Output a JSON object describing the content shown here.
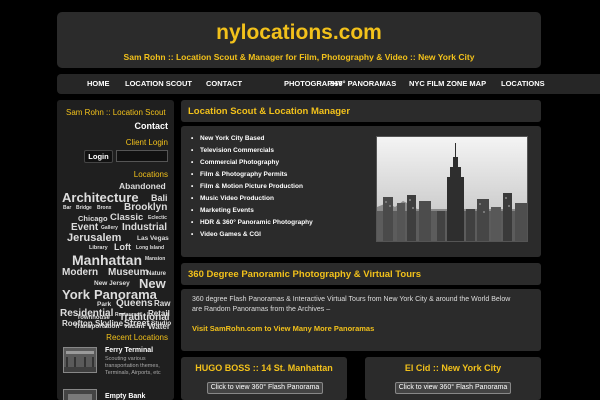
{
  "header": {
    "title": "nylocations.com",
    "subtitle": "Sam Rohn :: Location Scout & Manager for Film, Photography & Video :: New York City"
  },
  "nav": {
    "items": [
      "HOME",
      "LOCATION SCOUT",
      "CONTACT",
      "PHOTOGRAPHY",
      "360° PANORAMAS",
      "NYC FILM ZONE MAP",
      "LOCATIONS"
    ]
  },
  "sidebar": {
    "owner": "Sam Rohn :: Location Scout",
    "contact": "Contact",
    "client_login": "Client Login",
    "login_button": "Login",
    "locations_heading": "Locations",
    "tags": [
      "Abandoned",
      "Architecture",
      "Bali",
      "Bar",
      "Bridge",
      "Bronx",
      "Brooklyn",
      "Chicago",
      "Classic",
      "Eclectic",
      "Event",
      "Gallery",
      "Industrial",
      "Jerusalem",
      "Las Vegas",
      "Library",
      "Loft",
      "Long Island",
      "Manhattan",
      "Mansion",
      "Modern",
      "Museum",
      "Nature",
      "New Jersey",
      "New",
      "York",
      "Panorama",
      "Park",
      "Queens",
      "Raw",
      "Residential",
      "Restaurant",
      "Retail",
      "Rooftop",
      "Skyline",
      "Street",
      "Studio",
      "Townhouse",
      "Traditional",
      "Transportation",
      "vacant",
      "Water"
    ],
    "recent_heading": "Recent Locations",
    "recent": [
      {
        "title": "Ferry Terminal",
        "desc": "Scouting various transportation themes, Terminals, Airports, etc"
      },
      {
        "title": "Empty Bank",
        "desc": "…"
      }
    ]
  },
  "main": {
    "scout_heading": "Location Scout & Location Manager",
    "services": [
      "New York City Based",
      "Television Commercials",
      "Commercial Photography",
      "Film & Photography Permits",
      "Film & Motion Picture Production",
      "Music Video Production",
      "Marketing Events",
      "HDR & 360° Panoramic Photography",
      "Video Games & CGI"
    ],
    "pano_heading": "360 Degree Panoramic Photography & Virtual Tours",
    "pano_text": "360 degree Flash Panoramas & Interactive Virtual Tours from New York City & around the World Below are Random Panoramas from the Archives –",
    "pano_link": "Visit SamRohn.com to View Many More Panoramas",
    "cards": [
      {
        "title": "HUGO BOSS :: 14 St. Manhattan",
        "button": "Click to view 360° Flash Panorama"
      },
      {
        "title": "El Cid :: New York City",
        "button": "Click to view 360° Flash Panorama"
      }
    ]
  },
  "colors": {
    "accent": "#f2c11b",
    "panel": "#2b2b2b",
    "background": "#000000"
  }
}
